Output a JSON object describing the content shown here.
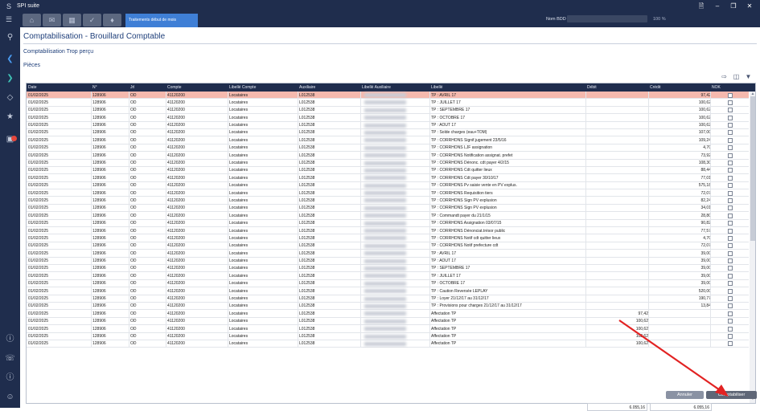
{
  "app": {
    "title": "SPI suite",
    "logo": "S"
  },
  "tabs": {
    "active_label": "Traitements début de mois"
  },
  "header": {
    "nombdd_label": "Nom BDD :",
    "zoom_label": "100 %"
  },
  "page": {
    "title": "Comptabilisation - Brouillard Comptable",
    "subtitle": "Comptabilisation Trop perçu",
    "section": "Pièces"
  },
  "grid": {
    "columns": [
      "Date",
      "N°",
      "Jrl",
      "Compte",
      "Libellé Compte",
      "Auxiliaire",
      "Libellé Auxiliaire",
      "Libellé",
      "Débit",
      "Crédit",
      "NOK"
    ],
    "rows": [
      {
        "date": "01/02/2025",
        "num": "128906",
        "jrl": "OD",
        "compte": "41120200",
        "libcompte": "Locataires",
        "aux": "L012538",
        "libelle": "TP : AVRIL    17",
        "debit": "",
        "credit": "97,42"
      },
      {
        "date": "01/02/2025",
        "num": "128906",
        "jrl": "OD",
        "compte": "41120200",
        "libcompte": "Locataires",
        "aux": "L012538",
        "libelle": "TP : JUILLET   17",
        "debit": "",
        "credit": "100,62"
      },
      {
        "date": "01/02/2025",
        "num": "128906",
        "jrl": "OD",
        "compte": "41120200",
        "libcompte": "Locataires",
        "aux": "L012538",
        "libelle": "TP : SEPTEMBRE 17",
        "debit": "",
        "credit": "100,62"
      },
      {
        "date": "01/02/2025",
        "num": "128906",
        "jrl": "OD",
        "compte": "41120200",
        "libcompte": "Locataires",
        "aux": "L012538",
        "libelle": "TP : OCTOBRE   17",
        "debit": "",
        "credit": "100,62"
      },
      {
        "date": "01/02/2025",
        "num": "128906",
        "jrl": "OD",
        "compte": "41120200",
        "libcompte": "Locataires",
        "aux": "L012538",
        "libelle": "TP : AOUT     17",
        "debit": "",
        "credit": "100,62"
      },
      {
        "date": "01/02/2025",
        "num": "128906",
        "jrl": "OD",
        "compte": "41120200",
        "libcompte": "Locataires",
        "aux": "L012538",
        "libelle": "TP : Solde charges (eau+TOM)",
        "debit": "",
        "credit": "107,00"
      },
      {
        "date": "01/02/2025",
        "num": "128906",
        "jrl": "OD",
        "compte": "41120200",
        "libcompte": "Locataires",
        "aux": "L012538",
        "libelle": "TP : CORRHONS Signif.jugement 23/5/16",
        "debit": "",
        "credit": "109,24"
      },
      {
        "date": "01/02/2025",
        "num": "128906",
        "jrl": "OD",
        "compte": "41120200",
        "libcompte": "Locataires",
        "aux": "L012538",
        "libelle": "TP : CORRHONS LJF assignation",
        "debit": "",
        "credit": "4,70"
      },
      {
        "date": "01/02/2025",
        "num": "128906",
        "jrl": "OD",
        "compte": "41120200",
        "libcompte": "Locataires",
        "aux": "L012538",
        "libelle": "TP : CORRHONS Notification assignat. prefet",
        "debit": "",
        "credit": "73,92"
      },
      {
        "date": "01/02/2025",
        "num": "128906",
        "jrl": "OD",
        "compte": "41120200",
        "libcompte": "Locataires",
        "aux": "L012538",
        "libelle": "TP : CORRHONS Dénonc. cdt payer 4/2/15",
        "debit": "",
        "credit": "108,30"
      },
      {
        "date": "01/02/2025",
        "num": "128906",
        "jrl": "OD",
        "compte": "41120200",
        "libcompte": "Locataires",
        "aux": "L012538",
        "libelle": "TP : CORRHONS Cdt quitter lieux",
        "debit": "",
        "credit": "88,44"
      },
      {
        "date": "01/02/2025",
        "num": "128906",
        "jrl": "OD",
        "compte": "41120200",
        "libcompte": "Locataires",
        "aux": "L012538",
        "libelle": "TP : CORRHONS Cdt payer 30/10/17",
        "debit": "",
        "credit": "77,01"
      },
      {
        "date": "01/02/2025",
        "num": "128906",
        "jrl": "OD",
        "compte": "41120200",
        "libcompte": "Locataires",
        "aux": "L012538",
        "libelle": "TP : CORRHONS Pv saisie vente  en PV explus.",
        "debit": "",
        "credit": "575,18"
      },
      {
        "date": "01/02/2025",
        "num": "128906",
        "jrl": "OD",
        "compte": "41120200",
        "libcompte": "Locataires",
        "aux": "L012538",
        "libelle": "TP : CORRHONS Requisition tiers",
        "debit": "",
        "credit": "72,07"
      },
      {
        "date": "01/02/2025",
        "num": "128906",
        "jrl": "OD",
        "compte": "41120200",
        "libcompte": "Locataires",
        "aux": "L012538",
        "libelle": "TP : CORRHONS Sign PV explusion",
        "debit": "",
        "credit": "82,24"
      },
      {
        "date": "01/02/2025",
        "num": "128906",
        "jrl": "OD",
        "compte": "41120200",
        "libcompte": "Locataires",
        "aux": "L012538",
        "libelle": "TP : CORRHONS Sign PV explusion",
        "debit": "",
        "credit": "34,01"
      },
      {
        "date": "01/02/2025",
        "num": "128906",
        "jrl": "OD",
        "compte": "41120200",
        "libcompte": "Locataires",
        "aux": "L012538",
        "libelle": "TP : Commandt payer du 21/1/15",
        "debit": "",
        "credit": "28,80"
      },
      {
        "date": "01/02/2025",
        "num": "128906",
        "jrl": "OD",
        "compte": "41120200",
        "libcompte": "Locataires",
        "aux": "L012538",
        "libelle": "TP : CORRHONS Assignation 03/07/15",
        "debit": "",
        "credit": "90,82"
      },
      {
        "date": "01/02/2025",
        "num": "128906",
        "jrl": "OD",
        "compte": "41120200",
        "libcompte": "Locataires",
        "aux": "L012538",
        "libelle": "TP : CORRHONS Dénonciat.trésor public",
        "debit": "",
        "credit": "77,57"
      },
      {
        "date": "01/02/2025",
        "num": "128906",
        "jrl": "OD",
        "compte": "41120200",
        "libcompte": "Locataires",
        "aux": "L012538",
        "libelle": "TP : CORRHONS Notif cdt quitter lieux",
        "debit": "",
        "credit": "4,70"
      },
      {
        "date": "01/02/2025",
        "num": "128906",
        "jrl": "OD",
        "compte": "41120200",
        "libcompte": "Locataires",
        "aux": "L012538",
        "libelle": "TP : CORRHONS Notif prefecture cdt",
        "debit": "",
        "credit": "72,07"
      },
      {
        "date": "01/02/2025",
        "num": "128906",
        "jrl": "OD",
        "compte": "41120200",
        "libcompte": "Locataires",
        "aux": "L012538",
        "libelle": "TP : AVRIL     17",
        "debit": "",
        "credit": "39,00"
      },
      {
        "date": "01/02/2025",
        "num": "128906",
        "jrl": "OD",
        "compte": "41120200",
        "libcompte": "Locataires",
        "aux": "L012538",
        "libelle": "TP : AOUT     17",
        "debit": "",
        "credit": "39,00"
      },
      {
        "date": "01/02/2025",
        "num": "128906",
        "jrl": "OD",
        "compte": "41120200",
        "libcompte": "Locataires",
        "aux": "L012538",
        "libelle": "TP : SEPTEMBRE 17",
        "debit": "",
        "credit": "39,00"
      },
      {
        "date": "01/02/2025",
        "num": "128906",
        "jrl": "OD",
        "compte": "41120200",
        "libcompte": "Locataires",
        "aux": "L012538",
        "libelle": "TP : JUILLET   17",
        "debit": "",
        "credit": "39,00"
      },
      {
        "date": "01/02/2025",
        "num": "128906",
        "jrl": "OD",
        "compte": "41120200",
        "libcompte": "Locataires",
        "aux": "L012538",
        "libelle": "TP : OCTOBRE   17",
        "debit": "",
        "credit": "39,00"
      },
      {
        "date": "01/02/2025",
        "num": "128906",
        "jrl": "OD",
        "compte": "41120200",
        "libcompte": "Locataires",
        "aux": "L012538",
        "libelle": "TP : Caution Reversée LEPLAY",
        "debit": "",
        "credit": "520,00"
      },
      {
        "date": "01/02/2025",
        "num": "128906",
        "jrl": "OD",
        "compte": "41120200",
        "libcompte": "Locataires",
        "aux": "L012538",
        "libelle": "TP : Loyer 21/12/17 au 31/12/17",
        "debit": "",
        "credit": "190,77"
      },
      {
        "date": "01/02/2025",
        "num": "128906",
        "jrl": "OD",
        "compte": "41120200",
        "libcompte": "Locataires",
        "aux": "L012538",
        "libelle": "TP : Provisions pour charges 21/12/17 au 31/12/17",
        "debit": "",
        "credit": "13,84"
      },
      {
        "date": "01/02/2025",
        "num": "128906",
        "jrl": "OD",
        "compte": "41120200",
        "libcompte": "Locataires",
        "aux": "L012538",
        "libelle": "Affectation TP",
        "debit": "97,42",
        "credit": ""
      },
      {
        "date": "01/02/2025",
        "num": "128906",
        "jrl": "OD",
        "compte": "41120200",
        "libcompte": "Locataires",
        "aux": "L012538",
        "libelle": "Affectation TP",
        "debit": "100,62",
        "credit": ""
      },
      {
        "date": "01/02/2025",
        "num": "128906",
        "jrl": "OD",
        "compte": "41120200",
        "libcompte": "Locataires",
        "aux": "L012538",
        "libelle": "Affectation TP",
        "debit": "100,62",
        "credit": ""
      },
      {
        "date": "01/02/2025",
        "num": "128906",
        "jrl": "OD",
        "compte": "41120200",
        "libcompte": "Locataires",
        "aux": "L012538",
        "libelle": "Affectation TP",
        "debit": "102,62",
        "credit": ""
      },
      {
        "date": "01/02/2025",
        "num": "128906",
        "jrl": "OD",
        "compte": "41120200",
        "libcompte": "Locataires",
        "aux": "L012538",
        "libelle": "Affectation TP",
        "debit": "100,62",
        "credit": ""
      }
    ],
    "total_debit": "6.055,16",
    "total_credit": "6.055,16"
  },
  "buttons": {
    "cancel": "Annuler",
    "submit": "Comptabiliser"
  },
  "colors": {
    "nav": "#1f2d4d",
    "accent": "#3f7fd6",
    "selected_row": "#f5b9ae",
    "annotation": "#e22222"
  }
}
